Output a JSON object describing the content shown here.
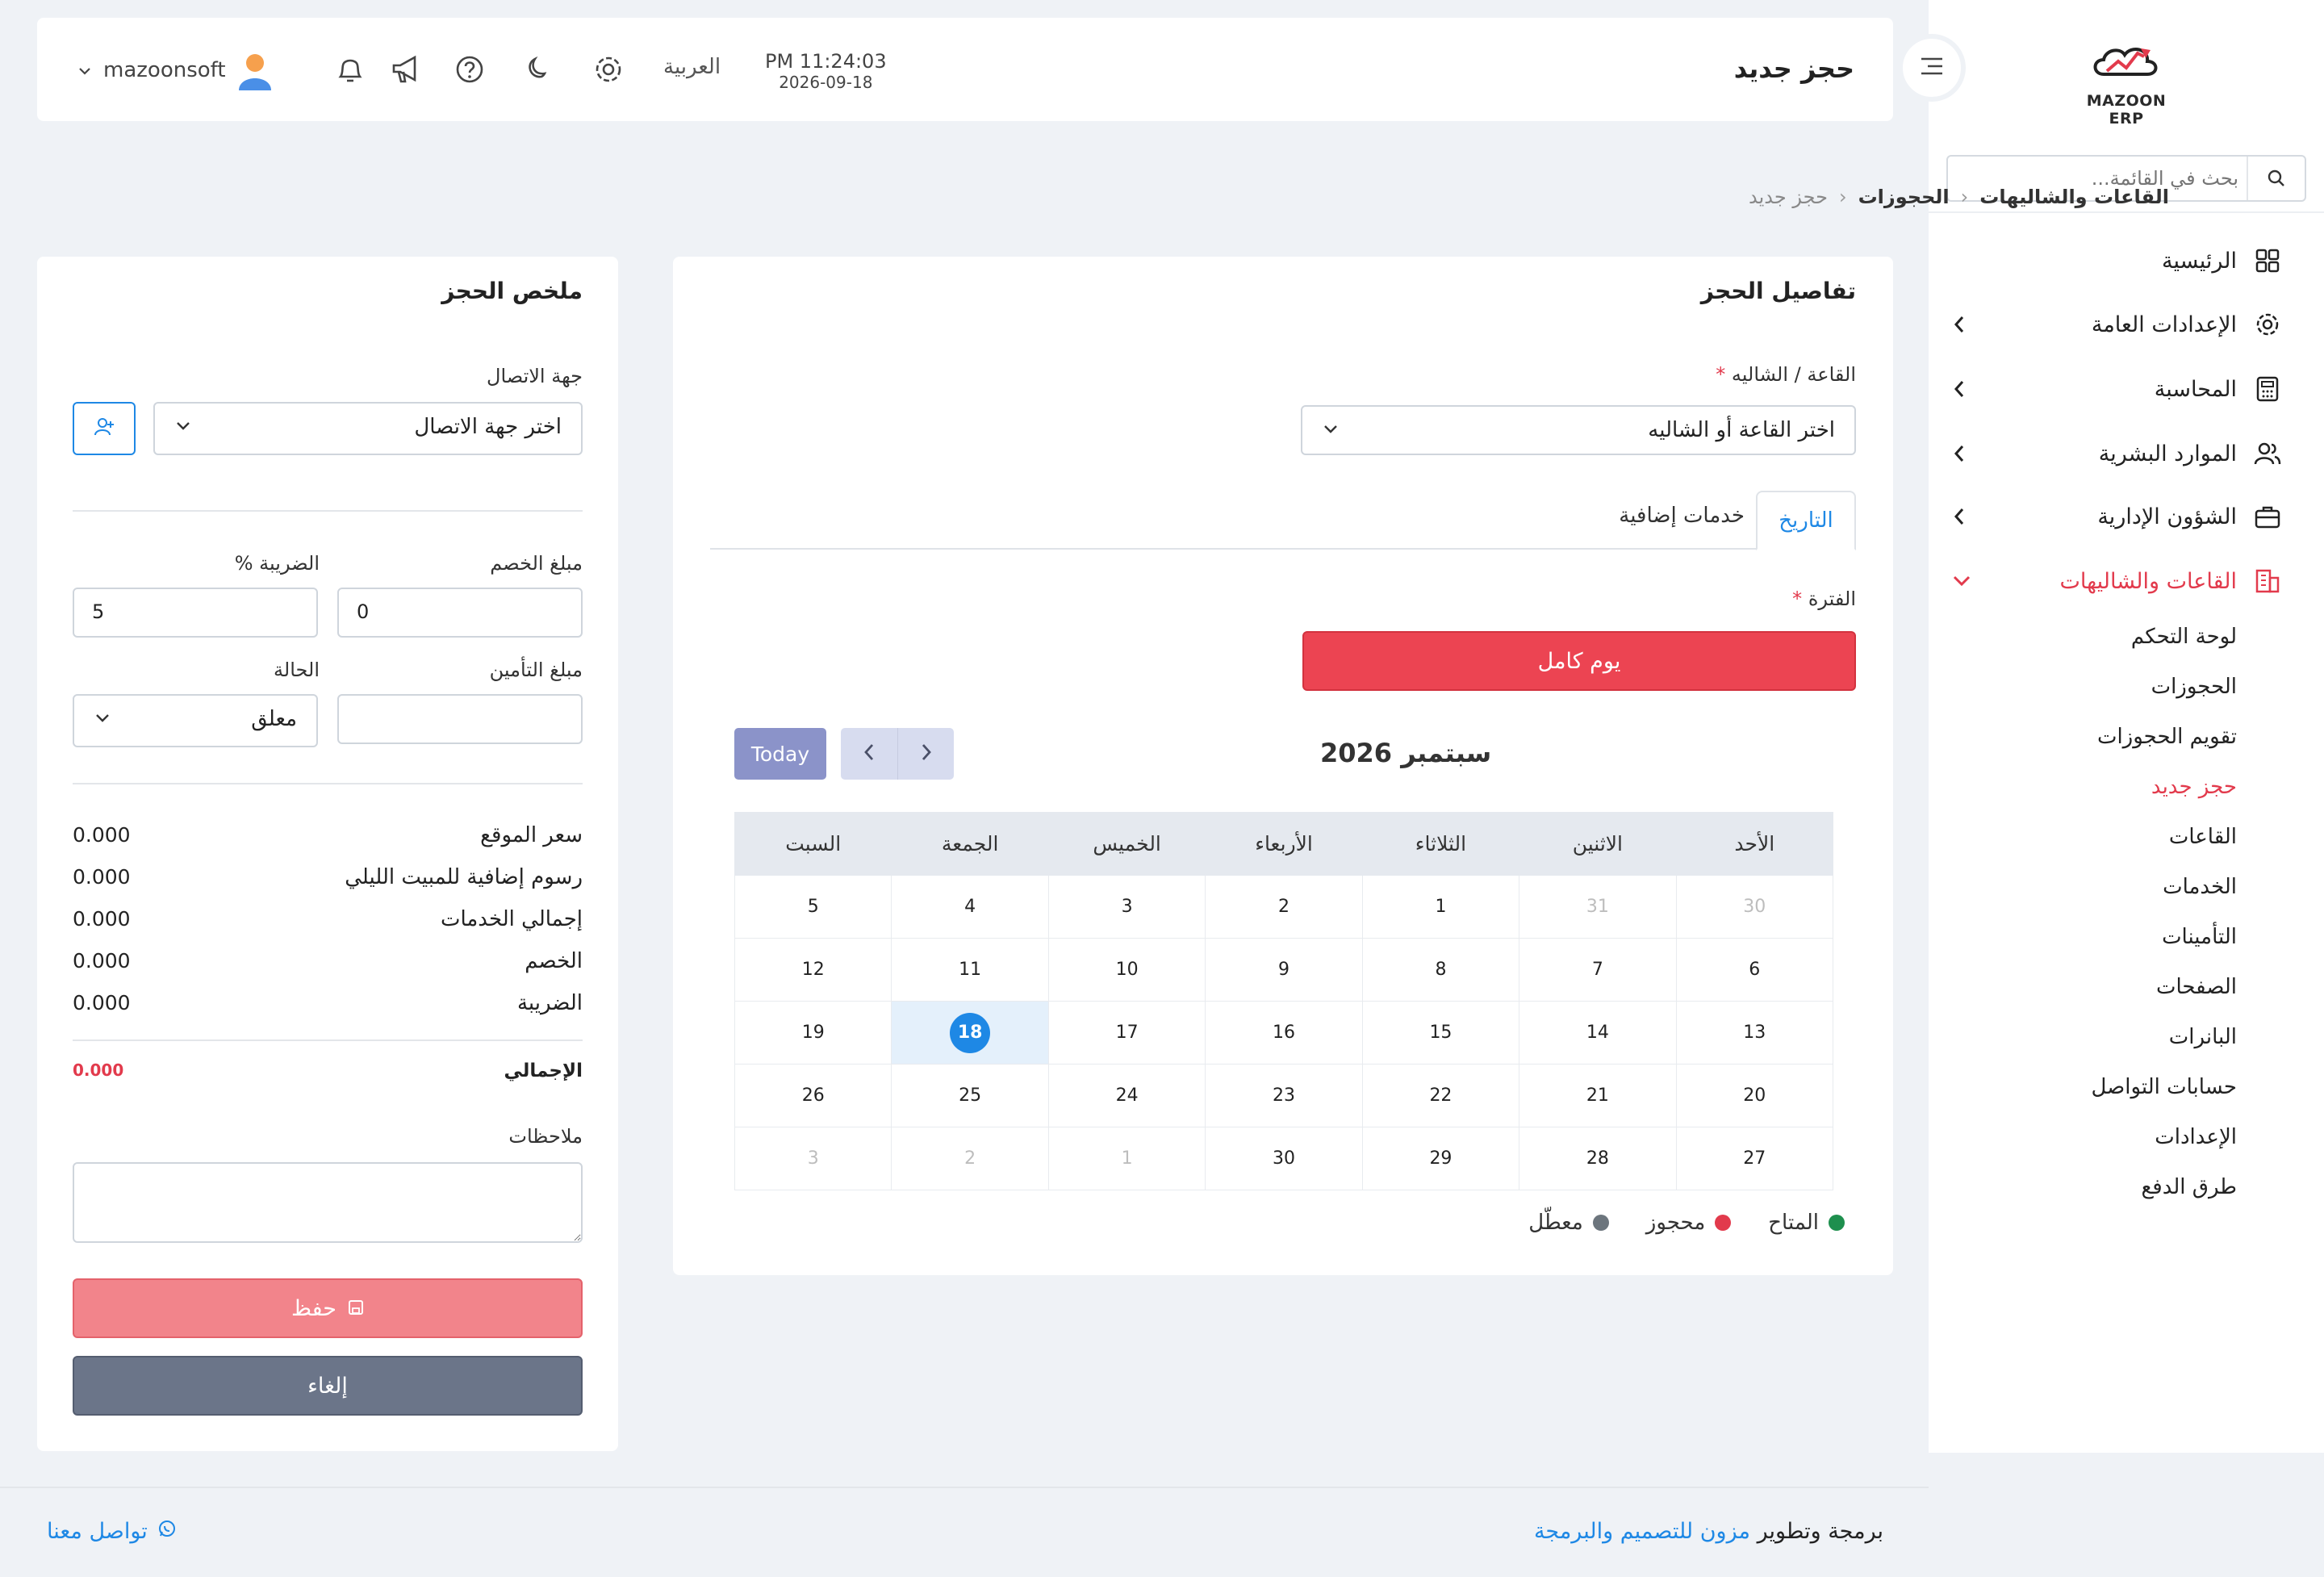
{
  "sidebar": {
    "logo_text": "MAZOON ERP",
    "search_placeholder": "بحث في القائمة...",
    "items": [
      {
        "label": "الرئيسية"
      },
      {
        "label": "الإعدادات العامة"
      },
      {
        "label": "المحاسبة"
      },
      {
        "label": "الموارد البشرية"
      },
      {
        "label": "الشؤون الإدارية"
      },
      {
        "label": "القاعات والشاليهات"
      }
    ],
    "sub_items": [
      {
        "label": "لوحة التحكم"
      },
      {
        "label": "الحجوزات"
      },
      {
        "label": "تقويم الحجوزات"
      },
      {
        "label": "حجز جديد"
      },
      {
        "label": "القاعات"
      },
      {
        "label": "الخدمات"
      },
      {
        "label": "التأمينات"
      },
      {
        "label": "الصفحات"
      },
      {
        "label": "البانرات"
      },
      {
        "label": "حسابات التواصل"
      },
      {
        "label": "الإعدادات"
      },
      {
        "label": "طرق الدفع"
      }
    ]
  },
  "header": {
    "title": "حجز جديد",
    "time": "PM 11:24:03",
    "date": "2026-09-18",
    "language": "العربية",
    "user": "mazoonsoft"
  },
  "breadcrumb": {
    "root": "القاعات والشاليهات",
    "section": "الحجوزات",
    "current": "حجز جديد"
  },
  "details": {
    "title": "تفاصيل الحجز",
    "hall_label": "القاعة / الشاليه",
    "required_mark": "*",
    "hall_placeholder": "اختر القاعة أو الشاليه",
    "tab_date": "التاريخ",
    "tab_extra": "خدمات إضافية",
    "period_label": "الفترة",
    "full_day": "يوم كامل",
    "today_btn": "Today",
    "calendar_title": "سبتمبر 2026",
    "weekdays": [
      "الأحد",
      "الاثنين",
      "الثلاثاء",
      "الأربعاء",
      "الخميس",
      "الجمعة",
      "السبت"
    ],
    "weeks": [
      [
        {
          "d": "30",
          "m": true
        },
        {
          "d": "31",
          "m": true
        },
        {
          "d": "1"
        },
        {
          "d": "2"
        },
        {
          "d": "3"
        },
        {
          "d": "4"
        },
        {
          "d": "5"
        }
      ],
      [
        {
          "d": "6"
        },
        {
          "d": "7"
        },
        {
          "d": "8"
        },
        {
          "d": "9"
        },
        {
          "d": "10"
        },
        {
          "d": "11"
        },
        {
          "d": "12"
        }
      ],
      [
        {
          "d": "13"
        },
        {
          "d": "14"
        },
        {
          "d": "15"
        },
        {
          "d": "16"
        },
        {
          "d": "17"
        },
        {
          "d": "18",
          "t": true
        },
        {
          "d": "19"
        }
      ],
      [
        {
          "d": "20"
        },
        {
          "d": "21"
        },
        {
          "d": "22"
        },
        {
          "d": "23"
        },
        {
          "d": "24"
        },
        {
          "d": "25"
        },
        {
          "d": "26"
        }
      ],
      [
        {
          "d": "27"
        },
        {
          "d": "28"
        },
        {
          "d": "29"
        },
        {
          "d": "30"
        },
        {
          "d": "1",
          "m": true
        },
        {
          "d": "2",
          "m": true
        },
        {
          "d": "3",
          "m": true
        }
      ]
    ],
    "legend": [
      {
        "label": "المتاح",
        "color": "#1e8f4e"
      },
      {
        "label": "محجوز",
        "color": "#e23a4c"
      },
      {
        "label": "معطّل",
        "color": "#6c757d"
      }
    ]
  },
  "summary": {
    "title": "ملخص الحجز",
    "contact_label": "جهة الاتصال",
    "contact_placeholder": "اختر جهة الاتصال",
    "discount_label": "مبلغ الخصم",
    "discount_value": "0",
    "tax_label": "الضريبة %",
    "tax_value": "5",
    "insurance_label": "مبلغ التأمين",
    "insurance_value": "",
    "status_label": "الحالة",
    "status_value": "معلق",
    "rows": [
      {
        "label": "سعر الموقع",
        "value": "0.000"
      },
      {
        "label": "رسوم إضافية للمبيت الليلي",
        "value": "0.000"
      },
      {
        "label": "إجمالي الخدمات",
        "value": "0.000"
      },
      {
        "label": "الخصم",
        "value": "0.000"
      },
      {
        "label": "الضريبة",
        "value": "0.000"
      }
    ],
    "total_label": "الإجمالي",
    "total_value": "0.000",
    "notes_label": "ملاحظات",
    "save_label": "حفظ",
    "cancel_label": "إلغاء"
  },
  "footer": {
    "credit_prefix": "برمجة وتطوير",
    "company": "مزون للتصميم والبرمجة",
    "contact": "تواصل معنا"
  },
  "colors": {
    "accent": "#e23a4c",
    "primary": "#1e88e5"
  }
}
